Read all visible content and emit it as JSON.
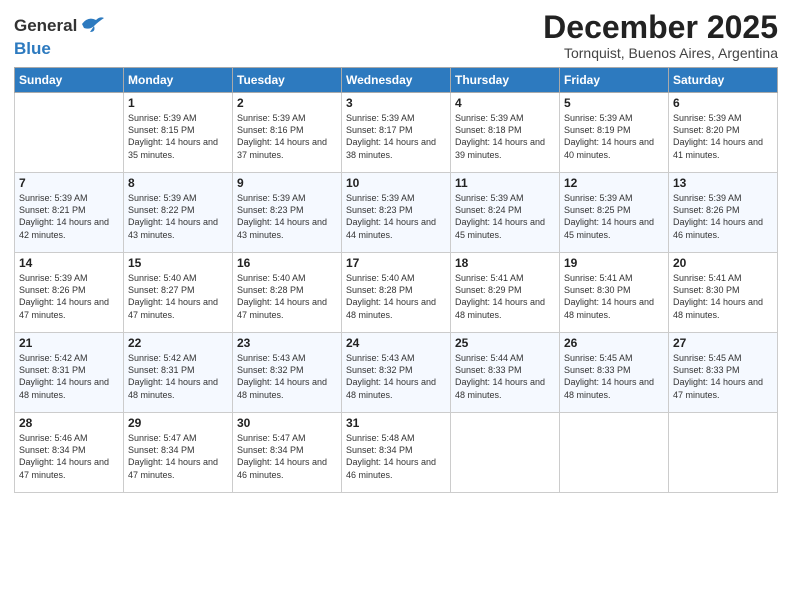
{
  "header": {
    "logo_general": "General",
    "logo_blue": "Blue",
    "month_year": "December 2025",
    "subtitle": "Tornquist, Buenos Aires, Argentina"
  },
  "days_of_week": [
    "Sunday",
    "Monday",
    "Tuesday",
    "Wednesday",
    "Thursday",
    "Friday",
    "Saturday"
  ],
  "weeks": [
    [
      {
        "day": "",
        "sunrise": "",
        "sunset": "",
        "daylight": ""
      },
      {
        "day": "1",
        "sunrise": "Sunrise: 5:39 AM",
        "sunset": "Sunset: 8:15 PM",
        "daylight": "Daylight: 14 hours and 35 minutes."
      },
      {
        "day": "2",
        "sunrise": "Sunrise: 5:39 AM",
        "sunset": "Sunset: 8:16 PM",
        "daylight": "Daylight: 14 hours and 37 minutes."
      },
      {
        "day": "3",
        "sunrise": "Sunrise: 5:39 AM",
        "sunset": "Sunset: 8:17 PM",
        "daylight": "Daylight: 14 hours and 38 minutes."
      },
      {
        "day": "4",
        "sunrise": "Sunrise: 5:39 AM",
        "sunset": "Sunset: 8:18 PM",
        "daylight": "Daylight: 14 hours and 39 minutes."
      },
      {
        "day": "5",
        "sunrise": "Sunrise: 5:39 AM",
        "sunset": "Sunset: 8:19 PM",
        "daylight": "Daylight: 14 hours and 40 minutes."
      },
      {
        "day": "6",
        "sunrise": "Sunrise: 5:39 AM",
        "sunset": "Sunset: 8:20 PM",
        "daylight": "Daylight: 14 hours and 41 minutes."
      }
    ],
    [
      {
        "day": "7",
        "sunrise": "Sunrise: 5:39 AM",
        "sunset": "Sunset: 8:21 PM",
        "daylight": "Daylight: 14 hours and 42 minutes."
      },
      {
        "day": "8",
        "sunrise": "Sunrise: 5:39 AM",
        "sunset": "Sunset: 8:22 PM",
        "daylight": "Daylight: 14 hours and 43 minutes."
      },
      {
        "day": "9",
        "sunrise": "Sunrise: 5:39 AM",
        "sunset": "Sunset: 8:23 PM",
        "daylight": "Daylight: 14 hours and 43 minutes."
      },
      {
        "day": "10",
        "sunrise": "Sunrise: 5:39 AM",
        "sunset": "Sunset: 8:23 PM",
        "daylight": "Daylight: 14 hours and 44 minutes."
      },
      {
        "day": "11",
        "sunrise": "Sunrise: 5:39 AM",
        "sunset": "Sunset: 8:24 PM",
        "daylight": "Daylight: 14 hours and 45 minutes."
      },
      {
        "day": "12",
        "sunrise": "Sunrise: 5:39 AM",
        "sunset": "Sunset: 8:25 PM",
        "daylight": "Daylight: 14 hours and 45 minutes."
      },
      {
        "day": "13",
        "sunrise": "Sunrise: 5:39 AM",
        "sunset": "Sunset: 8:26 PM",
        "daylight": "Daylight: 14 hours and 46 minutes."
      }
    ],
    [
      {
        "day": "14",
        "sunrise": "Sunrise: 5:39 AM",
        "sunset": "Sunset: 8:26 PM",
        "daylight": "Daylight: 14 hours and 47 minutes."
      },
      {
        "day": "15",
        "sunrise": "Sunrise: 5:40 AM",
        "sunset": "Sunset: 8:27 PM",
        "daylight": "Daylight: 14 hours and 47 minutes."
      },
      {
        "day": "16",
        "sunrise": "Sunrise: 5:40 AM",
        "sunset": "Sunset: 8:28 PM",
        "daylight": "Daylight: 14 hours and 47 minutes."
      },
      {
        "day": "17",
        "sunrise": "Sunrise: 5:40 AM",
        "sunset": "Sunset: 8:28 PM",
        "daylight": "Daylight: 14 hours and 48 minutes."
      },
      {
        "day": "18",
        "sunrise": "Sunrise: 5:41 AM",
        "sunset": "Sunset: 8:29 PM",
        "daylight": "Daylight: 14 hours and 48 minutes."
      },
      {
        "day": "19",
        "sunrise": "Sunrise: 5:41 AM",
        "sunset": "Sunset: 8:30 PM",
        "daylight": "Daylight: 14 hours and 48 minutes."
      },
      {
        "day": "20",
        "sunrise": "Sunrise: 5:41 AM",
        "sunset": "Sunset: 8:30 PM",
        "daylight": "Daylight: 14 hours and 48 minutes."
      }
    ],
    [
      {
        "day": "21",
        "sunrise": "Sunrise: 5:42 AM",
        "sunset": "Sunset: 8:31 PM",
        "daylight": "Daylight: 14 hours and 48 minutes."
      },
      {
        "day": "22",
        "sunrise": "Sunrise: 5:42 AM",
        "sunset": "Sunset: 8:31 PM",
        "daylight": "Daylight: 14 hours and 48 minutes."
      },
      {
        "day": "23",
        "sunrise": "Sunrise: 5:43 AM",
        "sunset": "Sunset: 8:32 PM",
        "daylight": "Daylight: 14 hours and 48 minutes."
      },
      {
        "day": "24",
        "sunrise": "Sunrise: 5:43 AM",
        "sunset": "Sunset: 8:32 PM",
        "daylight": "Daylight: 14 hours and 48 minutes."
      },
      {
        "day": "25",
        "sunrise": "Sunrise: 5:44 AM",
        "sunset": "Sunset: 8:33 PM",
        "daylight": "Daylight: 14 hours and 48 minutes."
      },
      {
        "day": "26",
        "sunrise": "Sunrise: 5:45 AM",
        "sunset": "Sunset: 8:33 PM",
        "daylight": "Daylight: 14 hours and 48 minutes."
      },
      {
        "day": "27",
        "sunrise": "Sunrise: 5:45 AM",
        "sunset": "Sunset: 8:33 PM",
        "daylight": "Daylight: 14 hours and 47 minutes."
      }
    ],
    [
      {
        "day": "28",
        "sunrise": "Sunrise: 5:46 AM",
        "sunset": "Sunset: 8:34 PM",
        "daylight": "Daylight: 14 hours and 47 minutes."
      },
      {
        "day": "29",
        "sunrise": "Sunrise: 5:47 AM",
        "sunset": "Sunset: 8:34 PM",
        "daylight": "Daylight: 14 hours and 47 minutes."
      },
      {
        "day": "30",
        "sunrise": "Sunrise: 5:47 AM",
        "sunset": "Sunset: 8:34 PM",
        "daylight": "Daylight: 14 hours and 46 minutes."
      },
      {
        "day": "31",
        "sunrise": "Sunrise: 5:48 AM",
        "sunset": "Sunset: 8:34 PM",
        "daylight": "Daylight: 14 hours and 46 minutes."
      },
      {
        "day": "",
        "sunrise": "",
        "sunset": "",
        "daylight": ""
      },
      {
        "day": "",
        "sunrise": "",
        "sunset": "",
        "daylight": ""
      },
      {
        "day": "",
        "sunrise": "",
        "sunset": "",
        "daylight": ""
      }
    ]
  ]
}
